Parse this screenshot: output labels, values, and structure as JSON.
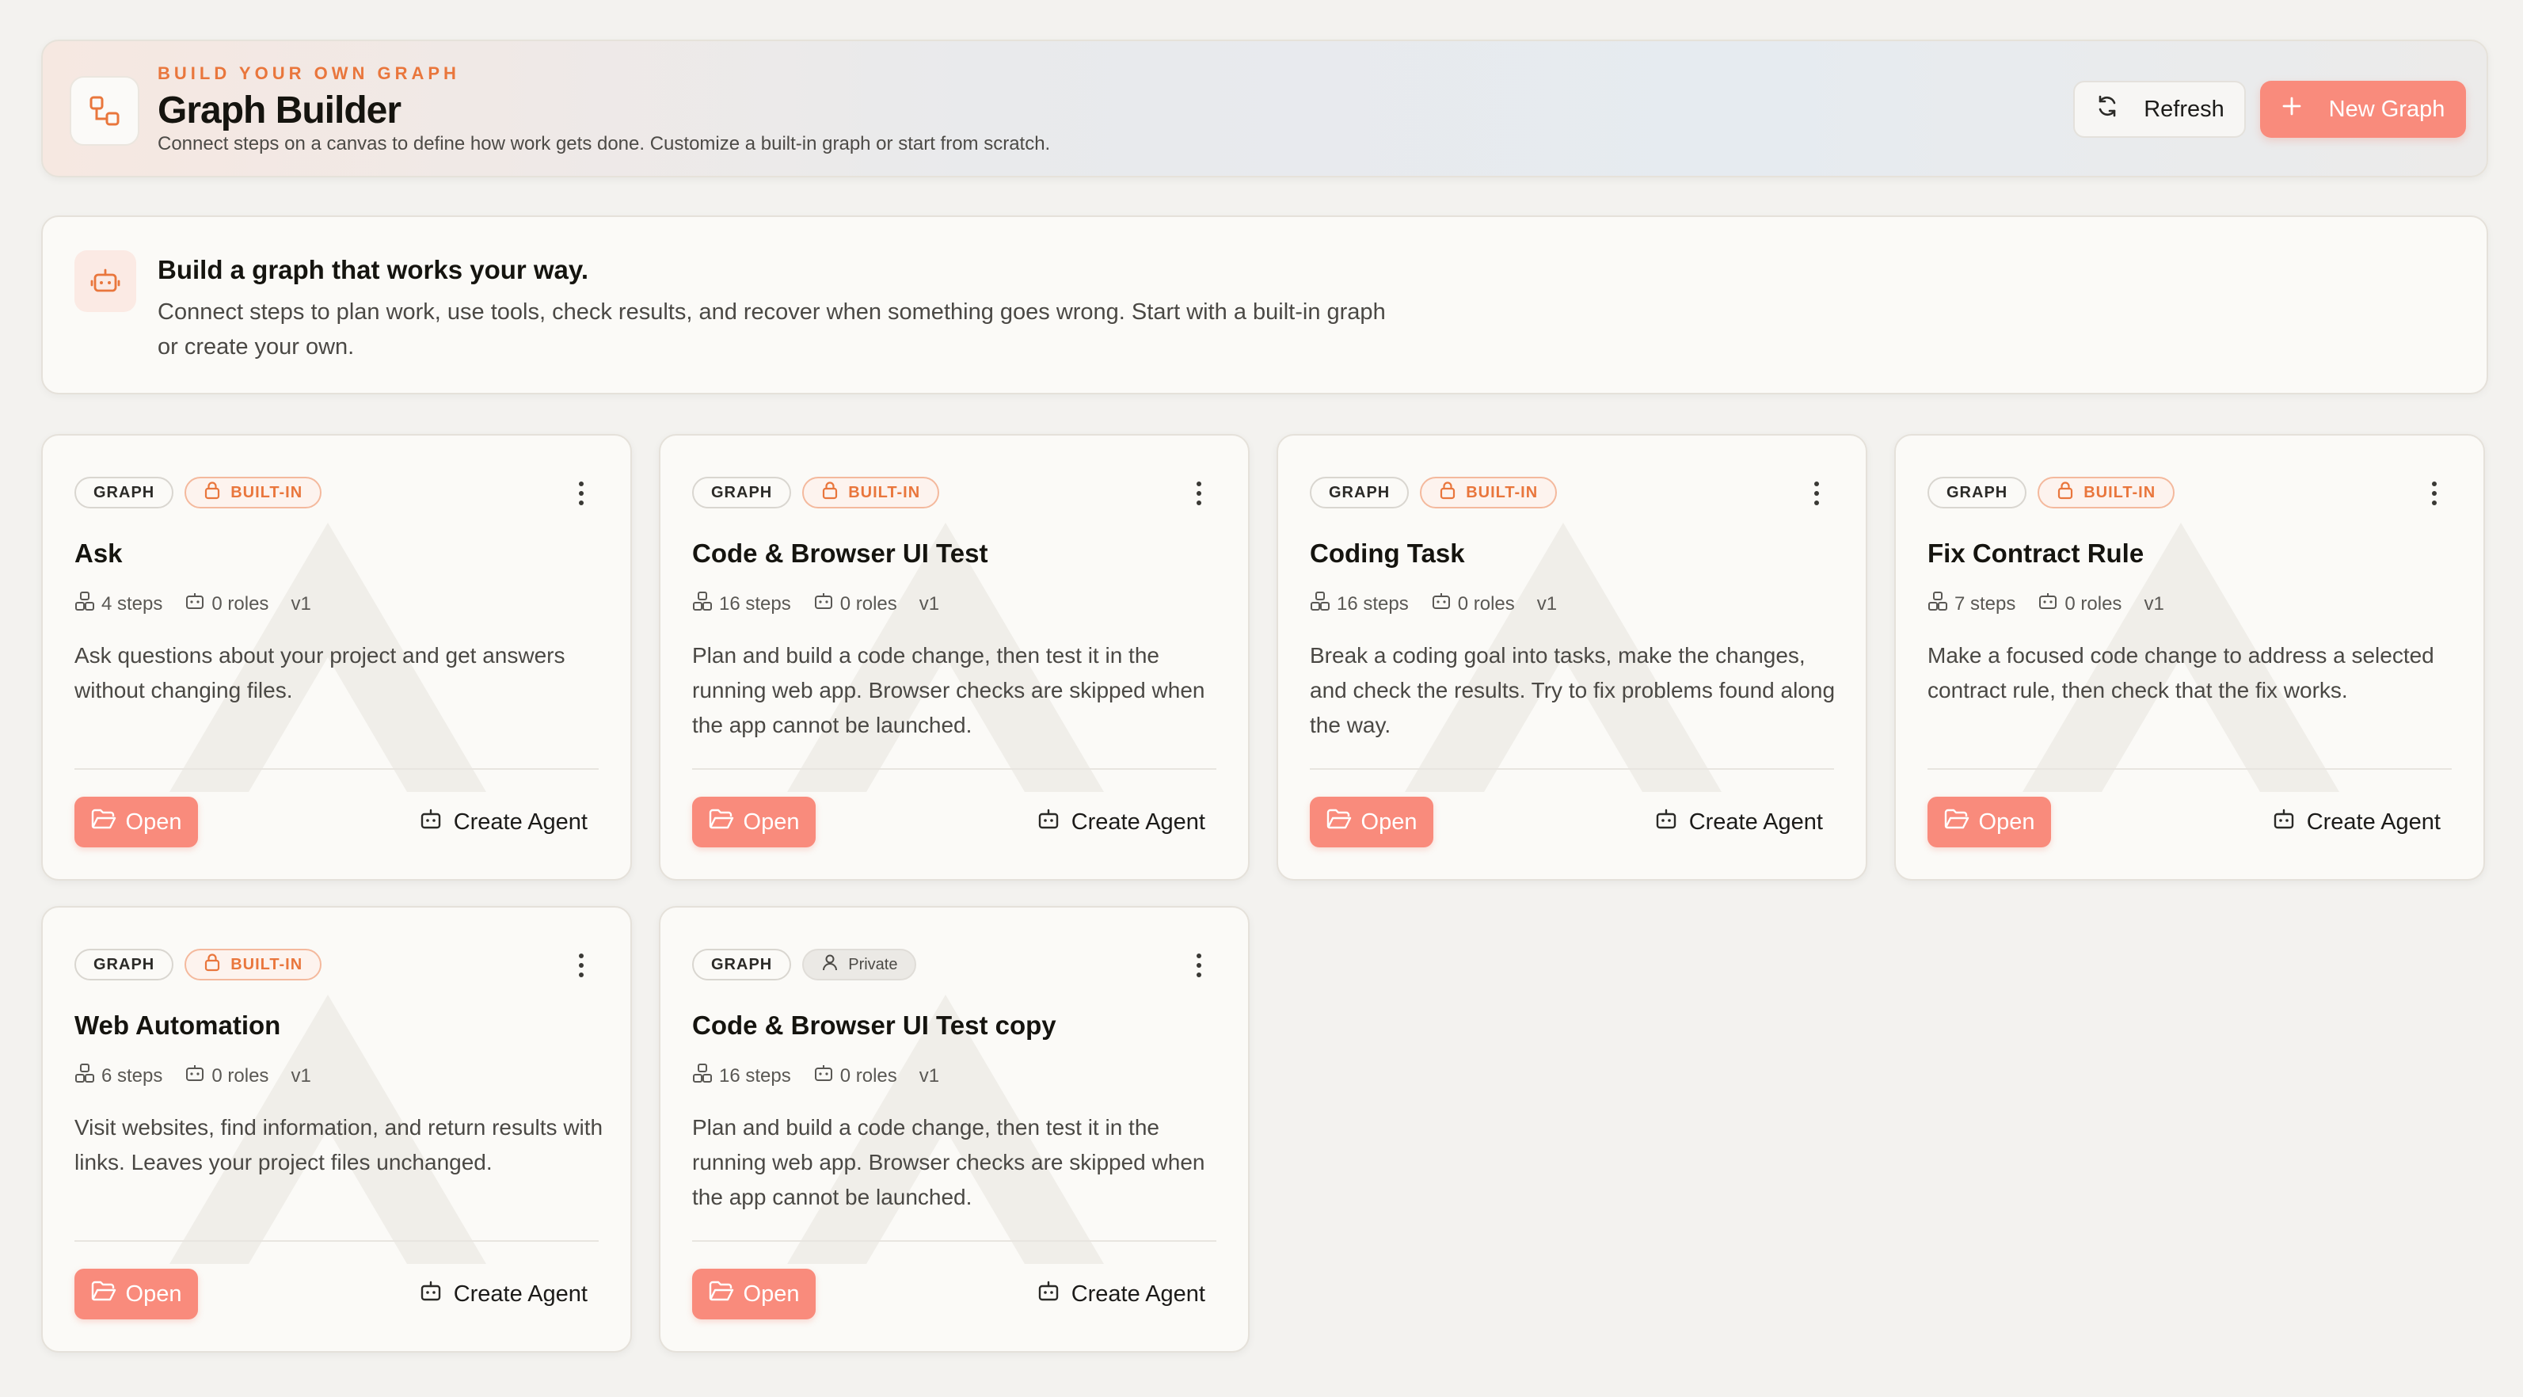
{
  "header": {
    "eyebrow": "BUILD YOUR OWN GRAPH",
    "title": "Graph Builder",
    "subtitle": "Connect steps on a canvas to define how work gets done. Customize a built-in graph or start from scratch.",
    "refresh_label": "Refresh",
    "new_graph_label": "New Graph",
    "icons": {
      "header": "graph-nodes-icon",
      "refresh": "refresh-icon",
      "new": "plus-icon"
    }
  },
  "intro": {
    "title": "Build a graph that works your way.",
    "text": "Connect steps to plan work, use tools, check results, and recover when something goes wrong. Start with a built-in graph or create your own.",
    "icon": "robot-icon"
  },
  "labels": {
    "graph_tag": "GRAPH",
    "builtin_tag": "BUILT-IN",
    "private_tag": "Private",
    "open": "Open",
    "create_agent": "Create Agent"
  },
  "colors": {
    "accent": "#e9763c",
    "button": "#f98b7c",
    "background": "#f3f2ef",
    "card": "#fbfaf7"
  },
  "cards": [
    {
      "title": "Ask",
      "steps": "4 steps",
      "roles": "0 roles",
      "version": "v1",
      "access": "BUILT-IN",
      "description": "Ask questions about your project and get answers without changing files."
    },
    {
      "title": "Code & Browser UI Test",
      "steps": "16 steps",
      "roles": "0 roles",
      "version": "v1",
      "access": "BUILT-IN",
      "description": "Plan and build a code change, then test it in the running web app. Browser checks are skipped when the app cannot be launched."
    },
    {
      "title": "Coding Task",
      "steps": "16 steps",
      "roles": "0 roles",
      "version": "v1",
      "access": "BUILT-IN",
      "description": "Break a coding goal into tasks, make the changes, and check the results. Try to fix problems found along the way."
    },
    {
      "title": "Fix Contract Rule",
      "steps": "7 steps",
      "roles": "0 roles",
      "version": "v1",
      "access": "BUILT-IN",
      "description": "Make a focused code change to address a selected contract rule, then check that the fix works."
    },
    {
      "title": "Web Automation",
      "steps": "6 steps",
      "roles": "0 roles",
      "version": "v1",
      "access": "BUILT-IN",
      "description": "Visit websites, find information, and return results with links. Leaves your project files unchanged."
    },
    {
      "title": "Code & Browser UI Test copy",
      "steps": "16 steps",
      "roles": "0 roles",
      "version": "v1",
      "access": "Private",
      "description": "Plan and build a code change, then test it in the running web app. Browser checks are skipped when the app cannot be launched."
    }
  ]
}
